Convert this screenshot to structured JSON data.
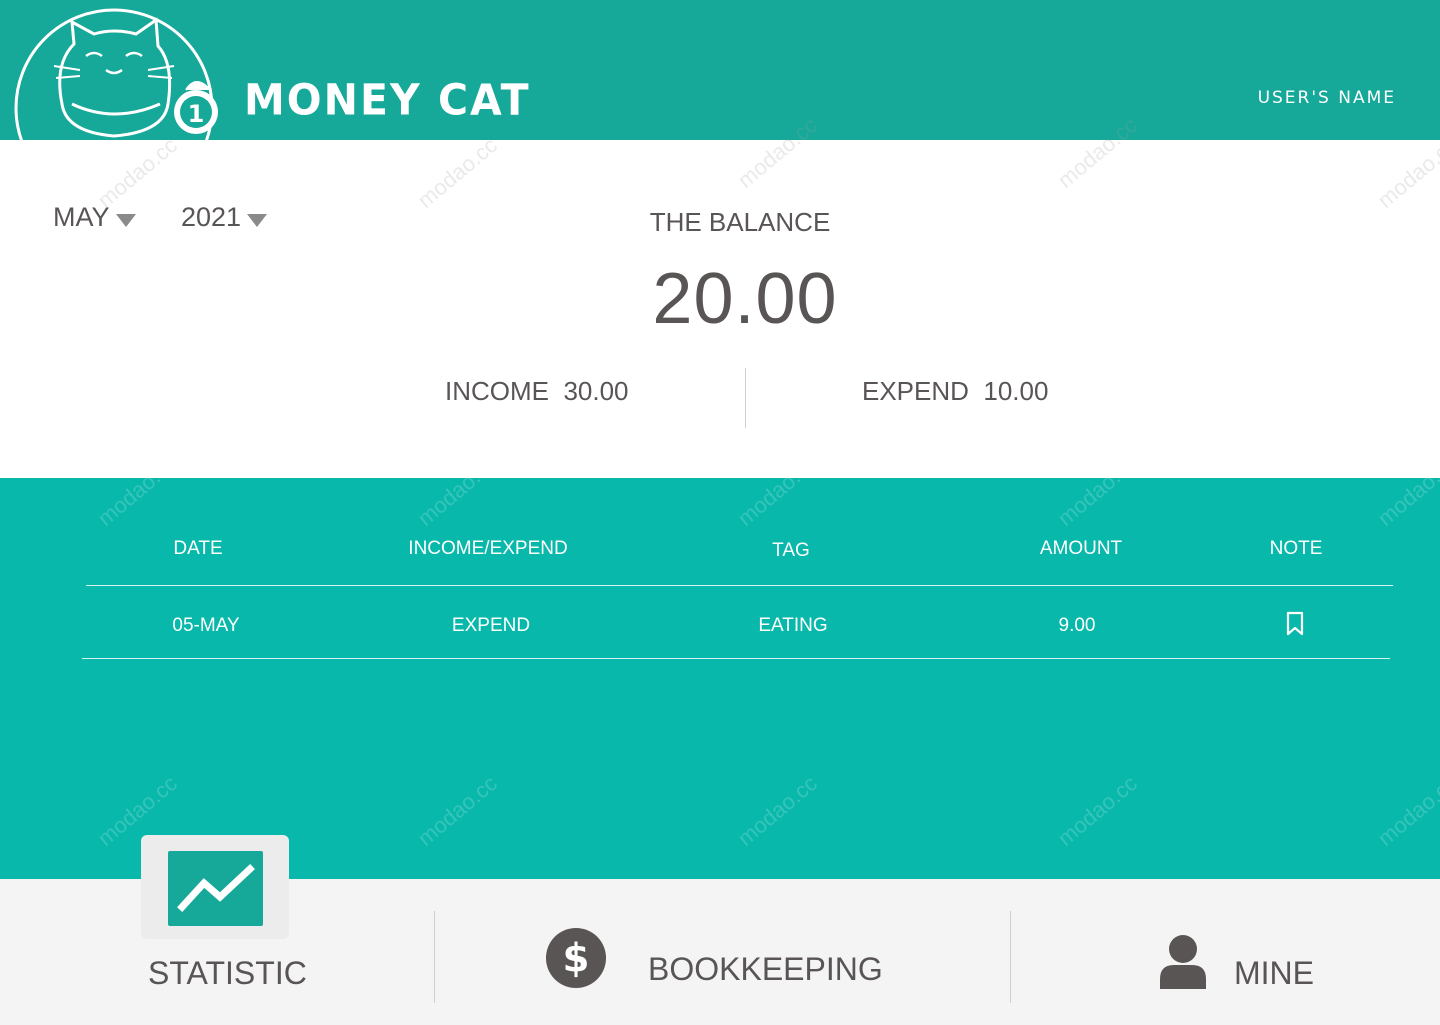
{
  "header": {
    "app_title": "MONEY CAT",
    "user_name": "USER'S NAME",
    "logo_icon": "lucky-cat-icon",
    "brand_color": "#16a899"
  },
  "summary": {
    "month": "MAY",
    "year": "2021",
    "balance_label": "THE BALANCE",
    "balance_value": "20.00",
    "income_label": "INCOME",
    "income_value": "30.00",
    "expend_label": "EXPEND",
    "expend_value": "10.00"
  },
  "records": {
    "columns": [
      "DATE",
      "INCOME/EXPEND",
      "TAG",
      "AMOUNT",
      "NOTE"
    ],
    "rows": [
      {
        "date": "05-MAY",
        "type": "EXPEND",
        "tag": "EATING",
        "amount": "9.00",
        "note_icon": "bookmark-icon"
      }
    ],
    "background_color": "#08b8aa"
  },
  "watermark": "modao.cc",
  "nav": {
    "items": [
      {
        "label": "STATISTIC",
        "icon": "trend-chart-icon",
        "active": true
      },
      {
        "label": "BOOKKEEPING",
        "icon": "dollar-coin-icon",
        "active": false
      },
      {
        "label": "MINE",
        "icon": "user-icon",
        "active": false
      }
    ]
  }
}
